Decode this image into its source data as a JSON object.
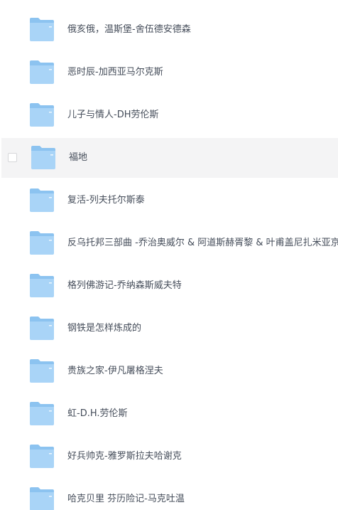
{
  "files": [
    {
      "name": "俄亥俄，温斯堡-舍伍德安德森",
      "hovered": false
    },
    {
      "name": "恶时辰-加西亚马尔克斯",
      "hovered": false
    },
    {
      "name": "儿子与情人-DH劳伦斯",
      "hovered": false
    },
    {
      "name": "福地",
      "hovered": true
    },
    {
      "name": "复活-列夫托尔斯泰",
      "hovered": false
    },
    {
      "name": "反乌托邦三部曲 -乔治奥威尔 & 阿道斯赫胥黎 & 叶甫盖尼扎米亚京",
      "hovered": false
    },
    {
      "name": "格列佛游记-乔纳森斯威夫特",
      "hovered": false
    },
    {
      "name": "钢铁是怎样炼成的",
      "hovered": false
    },
    {
      "name": "贵族之家-伊凡屠格涅夫",
      "hovered": false
    },
    {
      "name": "虹-D.H.劳伦斯",
      "hovered": false
    },
    {
      "name": "好兵帅克-雅罗斯拉夫哈谢克",
      "hovered": false
    },
    {
      "name": "哈克贝里 芬历险记-马克吐温",
      "hovered": false
    }
  ],
  "colors": {
    "folder_back": "#8cc3f0",
    "folder_front": "#a9d4f7",
    "text": "#454d5a",
    "hover_bg": "#f4f4f5"
  },
  "icons": {
    "folder": "folder-icon",
    "checkbox": "checkbox"
  }
}
